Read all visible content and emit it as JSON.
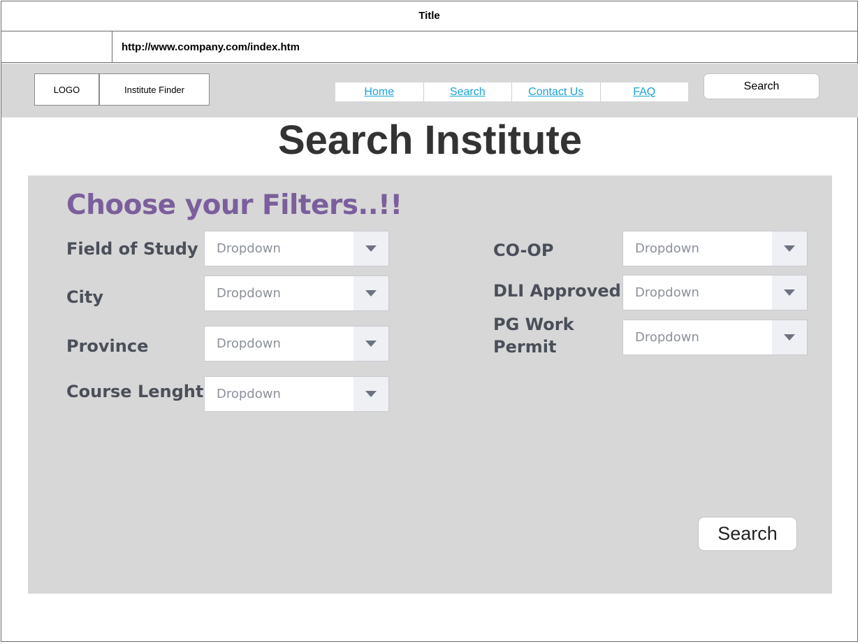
{
  "window": {
    "title": "Title",
    "url": "http://www.company.com/index.htm"
  },
  "header": {
    "logo": "LOGO",
    "brand": "Institute Finder",
    "nav": [
      {
        "label": "Home"
      },
      {
        "label": "Search"
      },
      {
        "label": "Contact Us"
      },
      {
        "label": "FAQ"
      }
    ],
    "search_button": "Search"
  },
  "page": {
    "title": "Search Institute"
  },
  "filters": {
    "heading": "Choose your Filters..!!",
    "left": [
      {
        "label": "Field of Study",
        "value": "Dropdown"
      },
      {
        "label": "City",
        "value": "Dropdown"
      },
      {
        "label": "Province",
        "value": "Dropdown"
      },
      {
        "label": "Course Lenght",
        "value": "Dropdown"
      }
    ],
    "right": [
      {
        "label": "CO-OP",
        "value": "Dropdown"
      },
      {
        "label": "DLI Approved",
        "value": "Dropdown"
      },
      {
        "label_line1": "PG Work",
        "label_line2": "Permit",
        "value": "Dropdown"
      }
    ],
    "search_button": "Search"
  },
  "colors": {
    "header_bg": "#d7d7d7",
    "link": "#1aa1d6",
    "heading_purple": "#7a5f9c",
    "label_text": "#4a4f59",
    "dropdown_placeholder": "#8b909b",
    "dropdown_button_bg": "#eff0f4"
  },
  "icons": {
    "dropdown_caret": "chevron-down-icon"
  }
}
